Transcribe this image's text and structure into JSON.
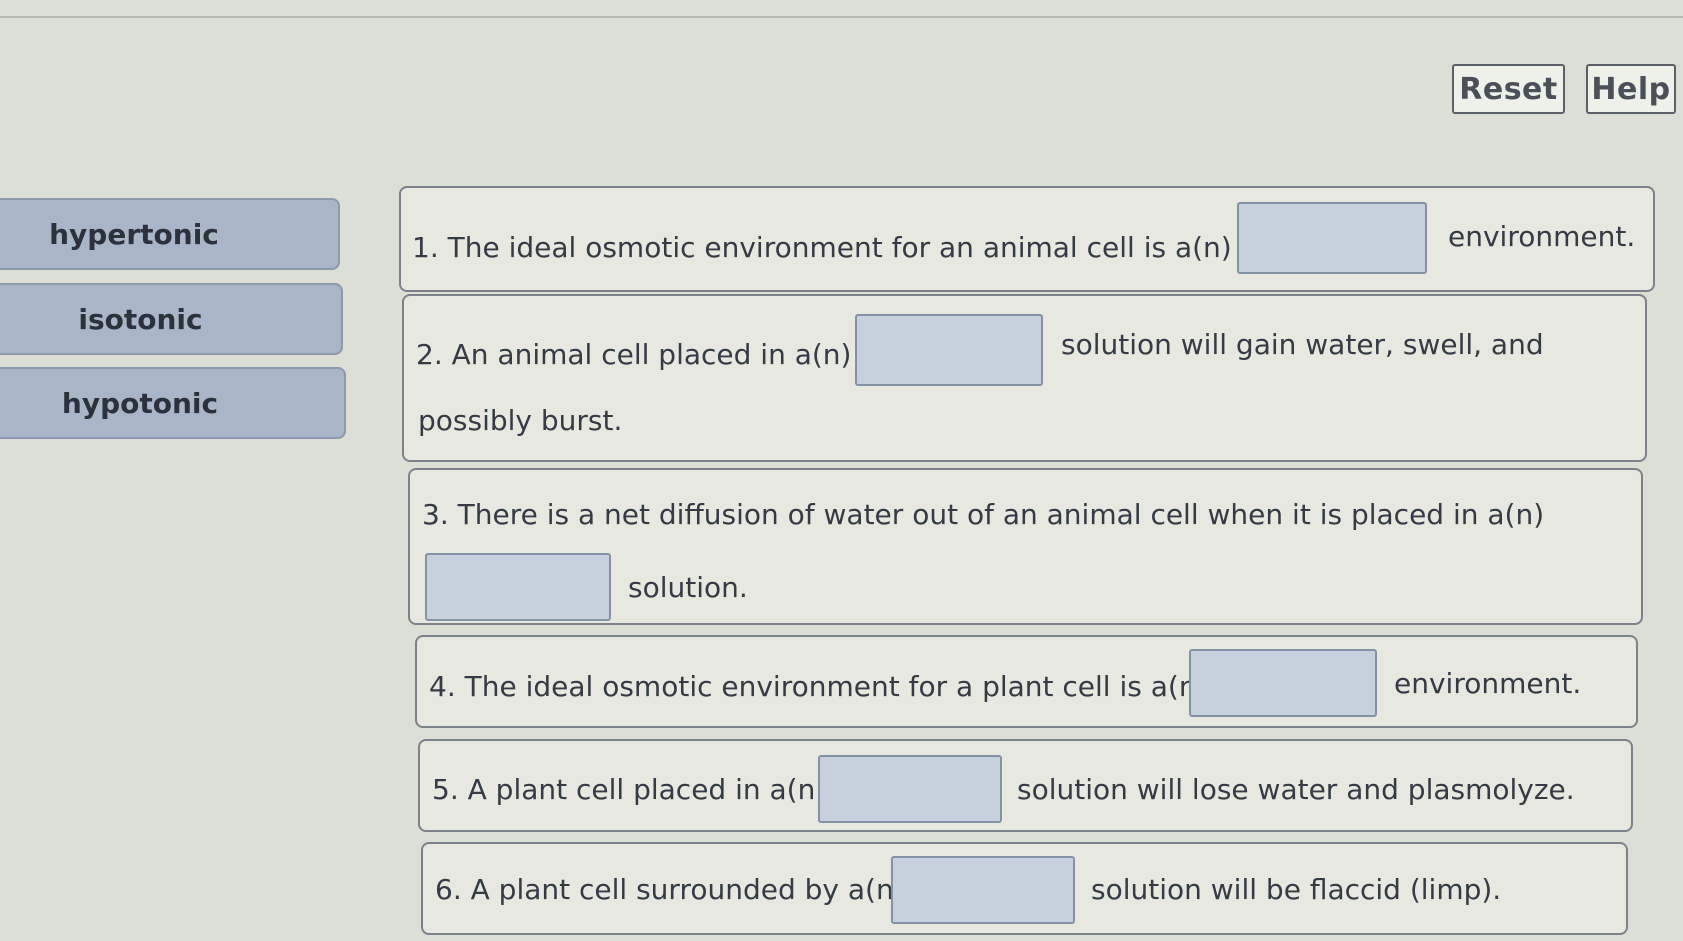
{
  "toolbar": {
    "reset_label": "Reset",
    "help_label": "Help"
  },
  "word_bank": [
    {
      "label": "hypertonic"
    },
    {
      "label": "isotonic"
    },
    {
      "label": "hypotonic"
    }
  ],
  "questions": [
    {
      "before": "1. The ideal osmotic environment for an animal cell is a(n)",
      "after": "environment."
    },
    {
      "before": "2. An animal cell placed in a(n)",
      "after": "solution will gain water, swell, and",
      "after_line2": "possibly burst."
    },
    {
      "before": "3. There is a net diffusion of water out of an animal cell when it is placed in a(n)",
      "after": "solution."
    },
    {
      "before": "4. The ideal osmotic environment for a plant cell is a(n)",
      "after": "environment."
    },
    {
      "before": "5. A plant cell placed in a(n)",
      "after": "solution will lose water and plasmolyze."
    },
    {
      "before": "6. A plant cell surrounded by a(n)",
      "after": "solution will be flaccid (limp)."
    }
  ]
}
